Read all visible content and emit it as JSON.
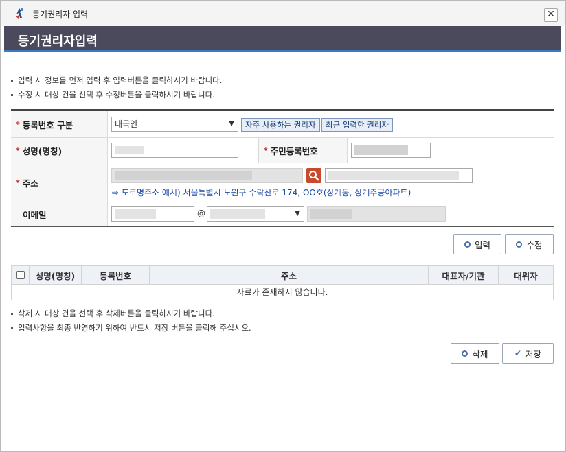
{
  "window": {
    "title": "등기권리자 입력",
    "header": "등기권리자입력",
    "close_symbol": "✕"
  },
  "notes_top": [
    "입력 시 정보를 먼저 입력 후 입력버튼을 클릭하시기 바랍니다.",
    "수정 시 대상 건을 선택 후 수정버튼을 클릭하시기 바랍니다."
  ],
  "form": {
    "reg_type": {
      "label": "등록번호 구분",
      "selected": "내국인",
      "btn_frequent": "자주 사용하는 권리자",
      "btn_recent": "최근 입력한 권리자"
    },
    "name": {
      "label": "성명(명칭)",
      "value": ""
    },
    "rrn": {
      "label": "주민등록번호",
      "value": ""
    },
    "address": {
      "label": "주소",
      "hint": "도로명주소 예시) 서울특별시 노원구 수락산로 174, OO호(상계동, 상계주공아파트)",
      "hint_icon": "arrow-right-icon",
      "search_icon": "search-icon"
    },
    "email": {
      "label": "이메일",
      "at": "@"
    }
  },
  "buttons": {
    "input": "입력",
    "edit": "수정",
    "delete": "삭제",
    "save": "저장"
  },
  "list": {
    "columns": [
      "성명(명칭)",
      "등록번호",
      "주소",
      "대표자/기관",
      "대위자"
    ],
    "empty_message": "자료가 존재하지 않습니다."
  },
  "notes_bottom": [
    "삭제 시 대상 건을 선택 후 삭제버튼을 클릭하시기 바랍니다.",
    "입력사항을 최종 반영하기 위하여 반드시 저장 버튼을 클릭해 주십시오."
  ],
  "colors": {
    "header_bg": "#4b4a5c",
    "header_accent": "#3d7bc7",
    "required_star": "#d02020",
    "search_button": "#c84a2c",
    "link": "#1a4aa8"
  }
}
